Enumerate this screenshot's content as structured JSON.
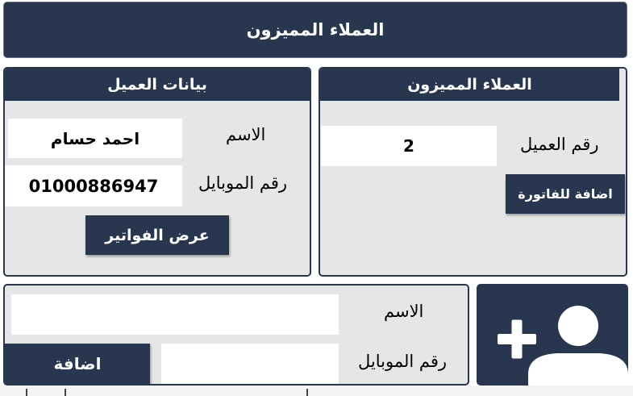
{
  "header": {
    "title": "العملاء المميزون"
  },
  "customer_panel": {
    "title": "بيانات العميل",
    "name_label": "الاسم",
    "name_value": "احمد حسام",
    "mobile_label": "رقم الموبايل",
    "mobile_value": "01000886947",
    "invoices_button": "عرض الفواتير"
  },
  "premium_panel": {
    "title": "العملاء المميزون",
    "customer_no_label": "رقم العميل",
    "customer_no_value": "2",
    "add_to_invoice_button": "اضافة للفاتورة"
  },
  "add_panel": {
    "name_label": "الاسم",
    "name_value": "",
    "mobile_label": "رقم الموبايل",
    "mobile_value": "",
    "add_button": "اضافة"
  },
  "add_user_tile": {
    "icon": "add-user-icon"
  },
  "colors": {
    "navy": "#283650",
    "panel_bg": "#e6e6e6",
    "field_bg": "#ffffff"
  }
}
